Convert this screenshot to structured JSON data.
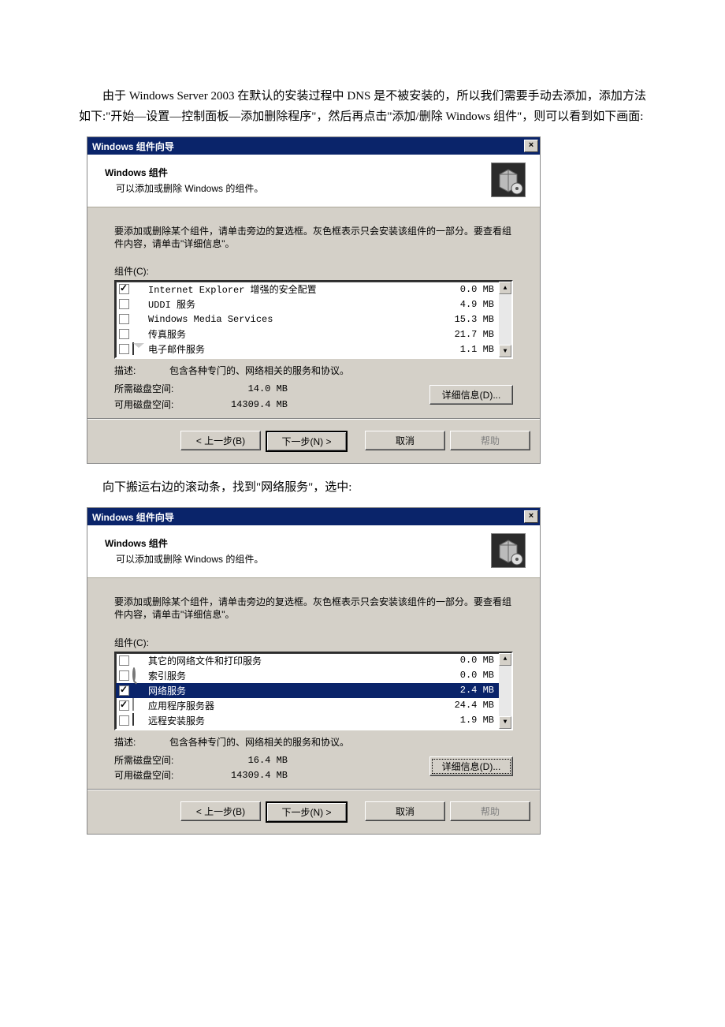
{
  "para1": "由于 Windows Server 2003 在默认的安装过程中 DNS 是不被安装的，所以我们需要手动去添加，添加方法如下:\"开始—设置—控制面板—添加删除程序\"，然后再点击\"添加/删除 Windows 组件\"，则可以看到如下画面:",
  "para2": "向下搬运右边的滚动条，找到\"网络服务\"，选中:",
  "dialog": {
    "title": "Windows 组件向导",
    "header_title": "Windows 组件",
    "header_sub": "可以添加或删除 Windows 的组件。",
    "instruction": "要添加或删除某个组件，请单击旁边的复选框。灰色框表示只会安装该组件的一部分。要查看组件内容，请单击\"详细信息\"。",
    "list_label": "组件(C):",
    "desc_label": "描述:",
    "required_label": "所需磁盘空间:",
    "available_label": "可用磁盘空间:",
    "details_btn": "详细信息(D)...",
    "btn_back": "< 上一步(B)",
    "btn_next": "下一步(N) >",
    "btn_cancel": "取消",
    "btn_help": "帮助"
  },
  "screen1": {
    "items": [
      {
        "checked": true,
        "icon": "ie",
        "label": "Internet Explorer 增强的安全配置",
        "size": "0.0 MB"
      },
      {
        "checked": false,
        "icon": "globe",
        "label": "UDDI 服务",
        "size": "4.9 MB"
      },
      {
        "checked": false,
        "icon": "wmp",
        "label": "Windows Media Services",
        "size": "15.3 MB"
      },
      {
        "checked": false,
        "icon": "fax",
        "label": "传真服务",
        "size": "21.7 MB"
      },
      {
        "checked": false,
        "icon": "mail",
        "label": "电子邮件服务",
        "size": "1.1 MB"
      }
    ],
    "description": "包含各种专门的、网络相关的服务和协议。",
    "required": "14.0 MB",
    "available": "14309.4 MB"
  },
  "screen2": {
    "items": [
      {
        "checked": false,
        "icon": "folder",
        "label": "其它的网络文件和打印服务",
        "size": "0.0 MB",
        "selected": false
      },
      {
        "checked": false,
        "icon": "search",
        "label": "索引服务",
        "size": "0.0 MB",
        "selected": false
      },
      {
        "checked": true,
        "icon": "net",
        "label": "网络服务",
        "size": "2.4 MB",
        "selected": true
      },
      {
        "checked": true,
        "icon": "app",
        "label": "应用程序服务器",
        "size": "24.4 MB",
        "selected": false
      },
      {
        "checked": false,
        "icon": "remote",
        "label": "远程安装服务",
        "size": "1.9 MB",
        "selected": false
      }
    ],
    "description": "包含各种专门的、网络相关的服务和协议。",
    "required": "16.4 MB",
    "available": "14309.4 MB"
  }
}
